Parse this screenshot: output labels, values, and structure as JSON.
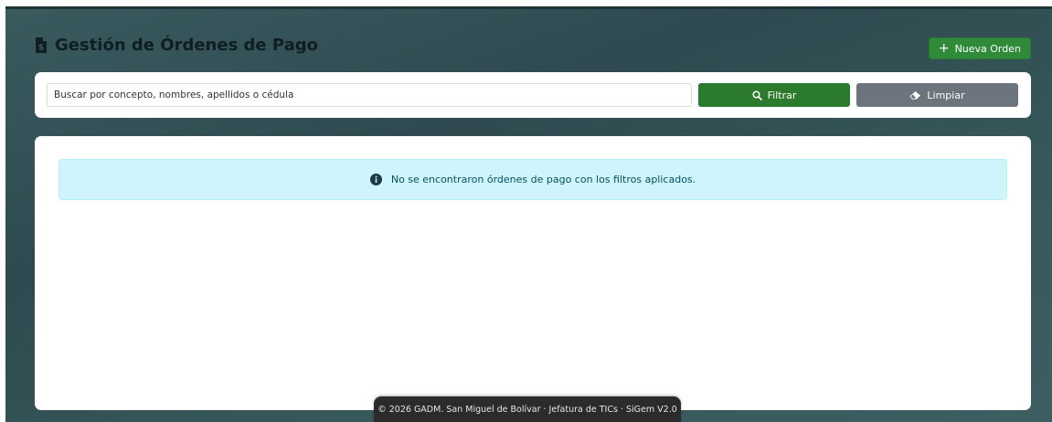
{
  "header": {
    "title": "Gestión de Órdenes de Pago",
    "title_icon": "file-invoice-dollar-icon",
    "new_order_label": "Nueva Orden"
  },
  "filters": {
    "search_placeholder": "Buscar por concepto, nombres, apellidos o cédula",
    "search_value": "",
    "filter_label": "Filtrar",
    "clear_label": "Limpiar"
  },
  "results": {
    "empty_message": "No se encontraron órdenes de pago con los filtros aplicados."
  },
  "footer": {
    "text": "© 2026 GADM. San Miguel de Bolívar · Jefatura de TICs  ·  SiGem V2.0"
  },
  "colors": {
    "primary_green": "#2f8a3a",
    "filter_green": "#2c7a2e",
    "secondary_gray": "#6c757d",
    "info_bg": "#cff4fc",
    "info_text": "#055160"
  }
}
